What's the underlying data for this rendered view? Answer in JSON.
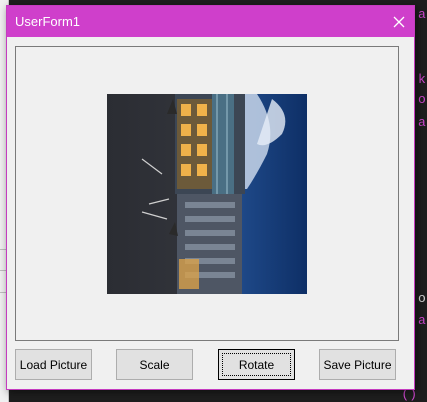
{
  "window": {
    "title": "UserForm1",
    "accent": "#cf3fcb",
    "close_icon": "close-icon"
  },
  "buttons": {
    "load_picture": "Load Picture",
    "scale": "Scale",
    "rotate": "Rotate",
    "save_picture": "Save Picture"
  },
  "picture": {
    "description_icon": "rotated-building-photo"
  },
  "background_editor": {
    "fragments": [
      "a",
      "k(",
      "ot",
      "a",
      "o)",
      "a"
    ],
    "bottom_text": "()"
  }
}
